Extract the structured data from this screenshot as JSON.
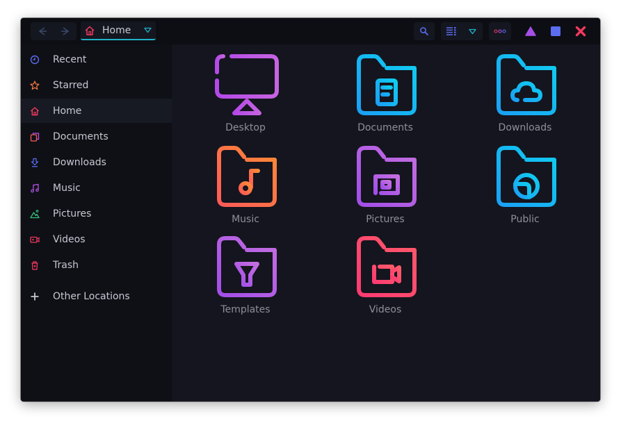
{
  "titlebar": {
    "location": "Home",
    "back_icon": "back-arrow-icon",
    "forward_icon": "forward-arrow-icon",
    "search_icon": "search-icon",
    "view_icon": "list-view-icon",
    "menu_icon": "more-dots-icon"
  },
  "window_controls": {
    "minimize_color": "#a64fe8",
    "maximize_color": "#5b6df0",
    "close_color": "#f0395e"
  },
  "sidebar": {
    "items": [
      {
        "label": "Recent",
        "icon": "clock-icon",
        "color": "#5b6df0"
      },
      {
        "label": "Starred",
        "icon": "star-icon",
        "color": "#ff7a45"
      },
      {
        "label": "Home",
        "icon": "home-icon",
        "color": "#f0395e",
        "active": true
      },
      {
        "label": "Documents",
        "icon": "documents-icon",
        "color": "#ff5a5a"
      },
      {
        "label": "Downloads",
        "icon": "download-icon",
        "color": "#5b6df0"
      },
      {
        "label": "Music",
        "icon": "music-icon",
        "color": "#b453e8"
      },
      {
        "label": "Pictures",
        "icon": "mountain-icon",
        "color": "#34c07a"
      },
      {
        "label": "Videos",
        "icon": "video-icon",
        "color": "#f0395e"
      },
      {
        "label": "Trash",
        "icon": "trash-icon",
        "color": "#f0395e"
      }
    ],
    "other_locations": {
      "label": "Other Locations",
      "icon": "plus-icon"
    }
  },
  "folders": [
    {
      "label": "Desktop",
      "icon": "desktop-monitor-icon",
      "color": "#b453e8"
    },
    {
      "label": "Documents",
      "icon": "folder-document-icon",
      "color": "#14b8f0"
    },
    {
      "label": "Downloads",
      "icon": "folder-cloud-icon",
      "color": "#14b8f0"
    },
    {
      "label": "Music",
      "icon": "folder-music-icon",
      "color": "#ff7048"
    },
    {
      "label": "Pictures",
      "icon": "folder-picture-icon",
      "color": "#b453e8"
    },
    {
      "label": "Public",
      "icon": "folder-globe-icon",
      "color": "#14b8f0"
    },
    {
      "label": "Templates",
      "icon": "folder-template-icon",
      "color": "#b453e8"
    },
    {
      "label": "Videos",
      "icon": "folder-video-icon",
      "color": "#ff4070"
    }
  ]
}
